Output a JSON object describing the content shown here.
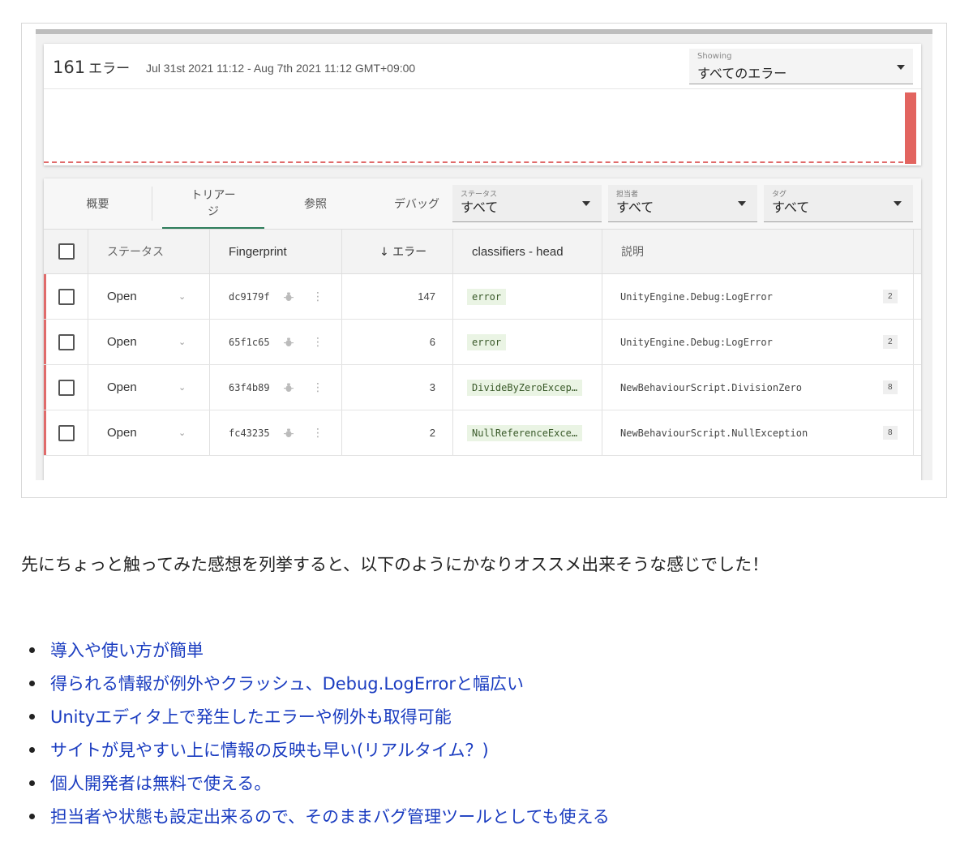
{
  "dashboard": {
    "error_count": "161",
    "error_unit": "エラー",
    "date_range": "Jul 31st 2021 11:12 - Aug 7th 2021 11:12 GMT+09:00",
    "showing": {
      "label": "Showing",
      "value": "すべてのエラー"
    }
  },
  "tabs": {
    "overview": "概要",
    "triage": "トリアージ",
    "browse": "参照",
    "debug": "デバッグ"
  },
  "filters": [
    {
      "label": "ステータス",
      "value": "すべて"
    },
    {
      "label": "担当者",
      "value": "すべて"
    },
    {
      "label": "タグ",
      "value": "すべて"
    }
  ],
  "table": {
    "headers": {
      "status": "ステータス",
      "fingerprint": "Fingerprint",
      "errors": "↓ エラー",
      "classifier": "classifiers - head",
      "description": "説明"
    },
    "rows": [
      {
        "status": "Open",
        "fingerprint": "dc9179f",
        "errors": "147",
        "classifier": "error",
        "description": "UnityEngine.Debug:LogError",
        "count": "2"
      },
      {
        "status": "Open",
        "fingerprint": "65f1c65",
        "errors": "6",
        "classifier": "error",
        "description": "UnityEngine.Debug:LogError",
        "count": "2"
      },
      {
        "status": "Open",
        "fingerprint": "63f4b89",
        "errors": "3",
        "classifier": "DivideByZeroExcep…",
        "description": "NewBehaviourScript.DivisionZero",
        "count": "8"
      },
      {
        "status": "Open",
        "fingerprint": "fc43235",
        "errors": "2",
        "classifier": "NullReferenceExce…",
        "description": "NewBehaviourScript.NullException",
        "count": "8"
      }
    ]
  },
  "article": {
    "intro": "先にちょっと触ってみた感想を列挙すると、以下のようにかなりオススメ出来そうな感じでした！",
    "bullets": [
      "導入や使い方が簡単",
      "得られる情報が例外やクラッシュ、Debug.LogErrorと幅広い",
      "Unityエディタ上で発生したエラーや例外も取得可能",
      "サイトが見やすい上に情報の反映も早い(リアルタイム？)",
      "個人開発者は無料で使える。",
      "担当者や状態も設定出来るので、そのままバグ管理ツールとしても使える"
    ]
  },
  "colors": {
    "accent_red": "#e2645f",
    "tab_underline": "#2e7d5b",
    "link_blue": "#1a3cc0",
    "chip_bg": "#eaf4e4"
  }
}
